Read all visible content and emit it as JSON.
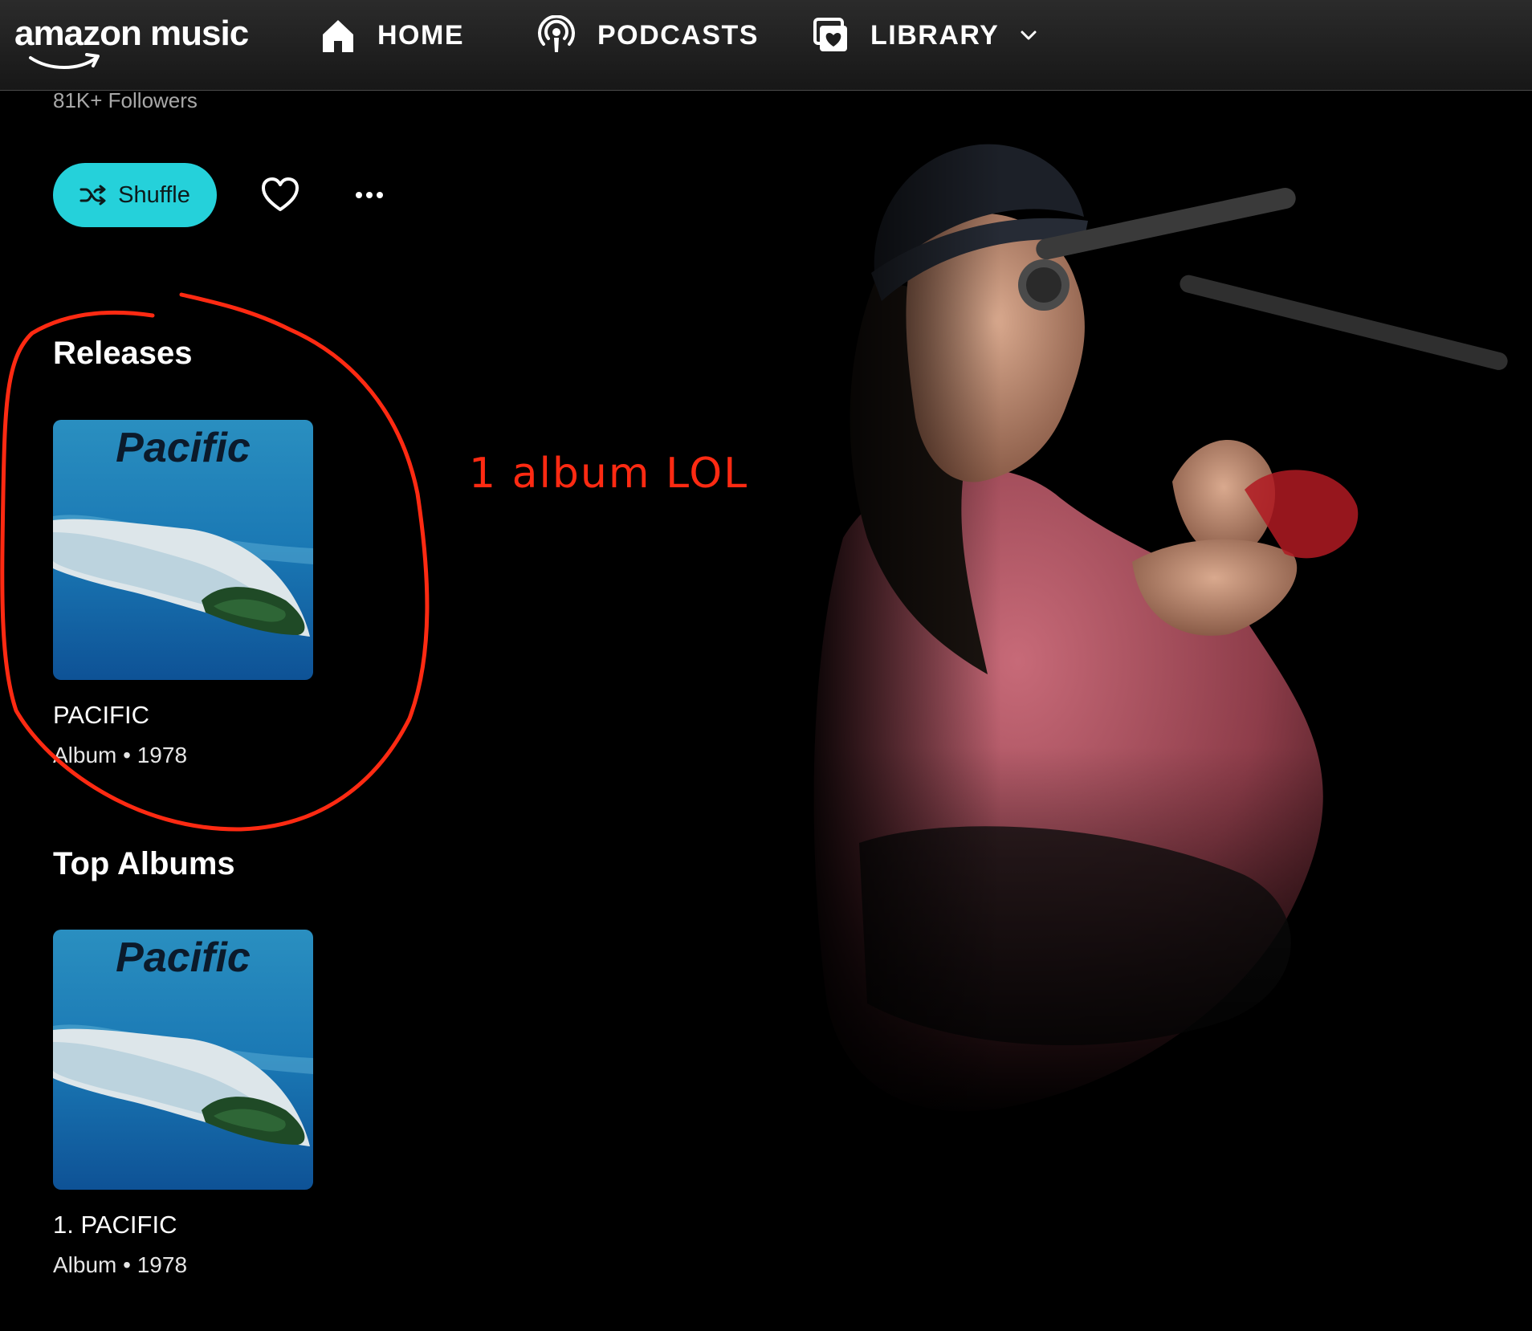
{
  "app": {
    "logo_text": "amazon music"
  },
  "nav": {
    "home": "HOME",
    "podcasts": "PODCASTS",
    "library": "LIBRARY"
  },
  "artist": {
    "followers": "81K+ Followers"
  },
  "actions": {
    "shuffle_label": "Shuffle"
  },
  "releases": {
    "title": "Releases",
    "items": [
      {
        "cover_text": "Pacific",
        "title": "PACIFIC",
        "subtitle": "Album • 1978"
      }
    ]
  },
  "top_albums": {
    "title": "Top Albums",
    "items": [
      {
        "cover_text": "Pacific",
        "title": "1. PACIFIC",
        "subtitle": "Album • 1978"
      }
    ]
  },
  "annotation": {
    "text": "1 album LOL",
    "color": "#ff2a12"
  },
  "colors": {
    "accent": "#25d1da",
    "background": "#000000"
  },
  "icons": {
    "home": "home-icon",
    "podcasts": "podcast-icon",
    "library": "library-icon",
    "chevron": "chevron-down-icon",
    "shuffle": "shuffle-icon",
    "heart": "heart-icon",
    "more": "more-icon"
  }
}
